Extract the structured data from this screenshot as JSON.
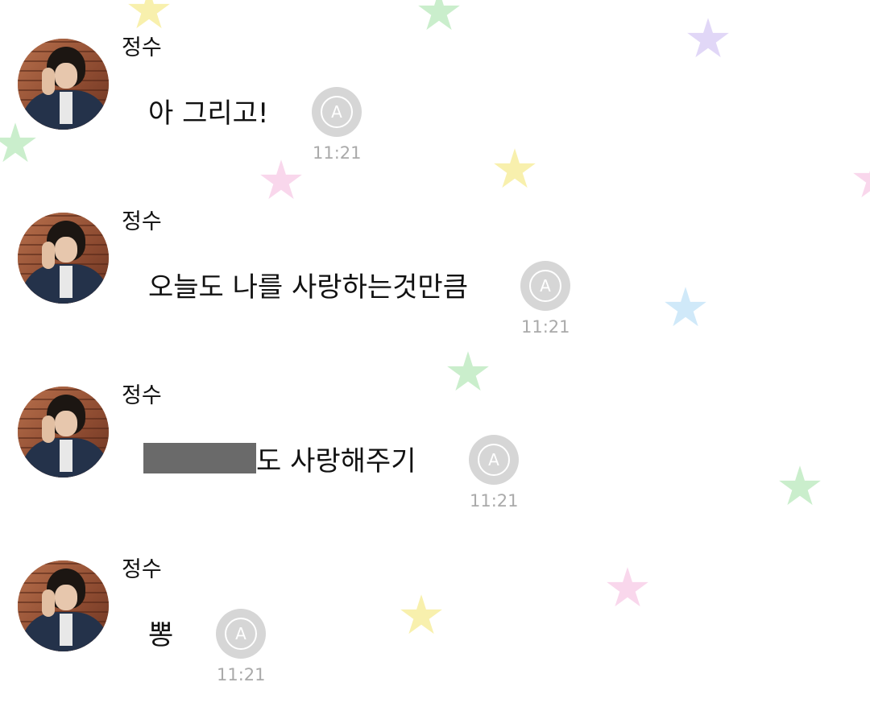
{
  "sender_name": "정수",
  "messages": [
    {
      "text": "아 그리고!",
      "time": "11:21"
    },
    {
      "text": "오늘도 나를 사랑하는것만큼",
      "time": "11:21"
    },
    {
      "text_before": "",
      "redacted": true,
      "text": "도 사랑해주기",
      "time": "11:21"
    },
    {
      "text": "뽕",
      "time": "11:21"
    }
  ],
  "icons": {
    "translate": "translate-icon",
    "translate_glyph": "A"
  },
  "colors": {
    "background": "#ffffff",
    "bubble": "#ffffff",
    "translate_icon": "#d6d6d6",
    "time": "#aaaaaa"
  }
}
